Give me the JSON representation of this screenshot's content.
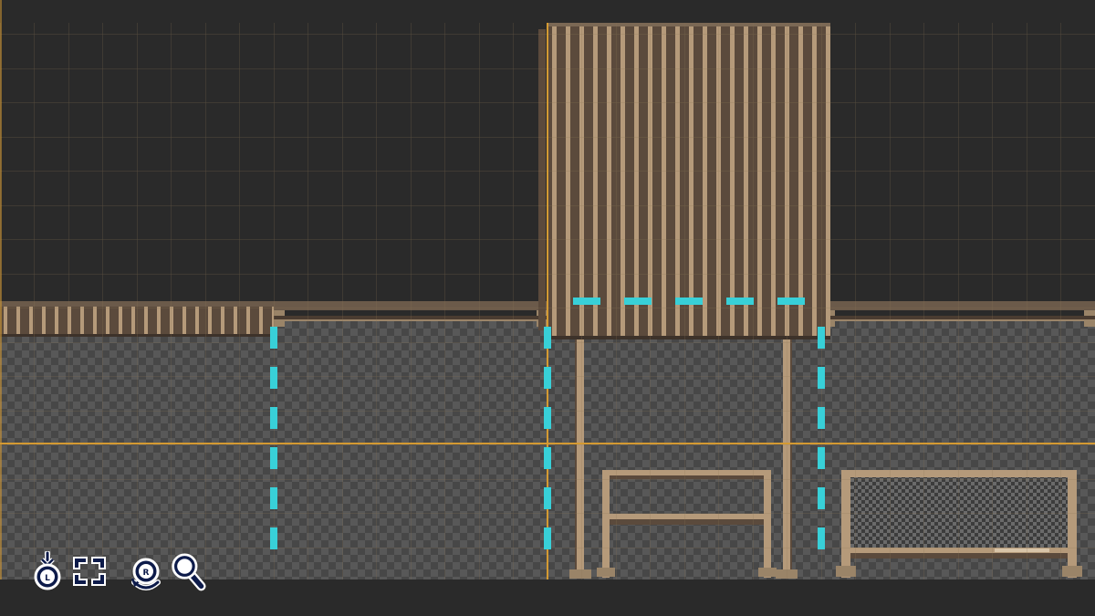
{
  "colors": {
    "background": "#2a2a2a",
    "floor_checker_dark": "#474747",
    "floor_checker_light": "#585858",
    "grid_line": "#8a7454",
    "axis_line": "#d49a32",
    "wall_brown": "#5b4a3c",
    "wall_light": "#b59a7a",
    "collision_marker": "#38d0d8",
    "hud_icon_fill": "#0d1b4a",
    "hud_icon_stroke": "#ffffff"
  },
  "hud": {
    "buttons": [
      {
        "id": "pin-down",
        "letter": "L",
        "icon": "pin-down-icon"
      },
      {
        "id": "fit-view",
        "letter": "",
        "icon": "fullscreen-brackets-icon"
      },
      {
        "id": "rotate-view",
        "letter": "R",
        "icon": "rotate-stick-icon"
      },
      {
        "id": "zoom",
        "letter": "",
        "icon": "magnifier-icon"
      }
    ]
  }
}
